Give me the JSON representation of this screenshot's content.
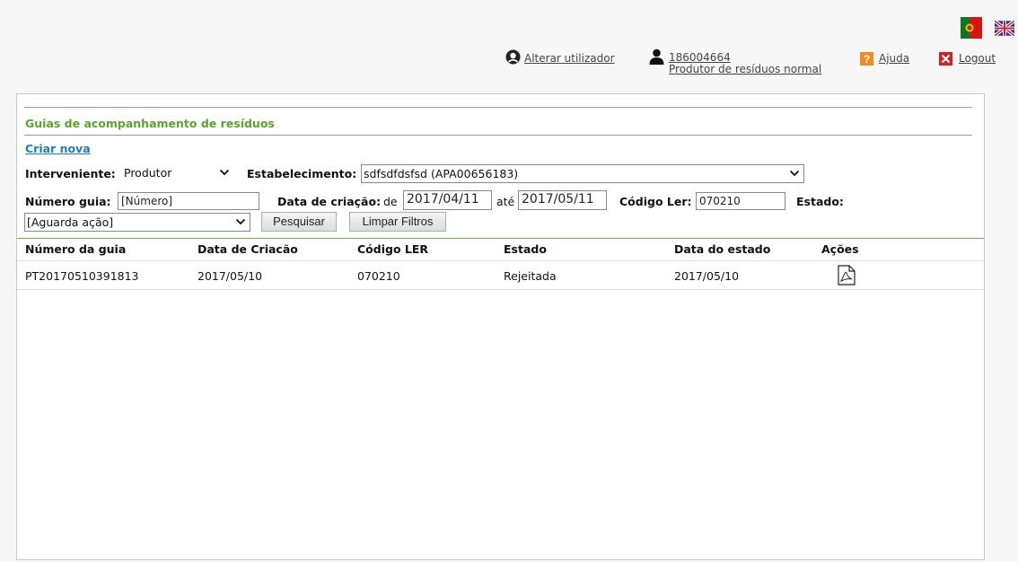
{
  "languages": [
    "Português",
    "English"
  ],
  "topbar": {
    "change_user": "Alterar utilizador",
    "user_id": "186004664",
    "user_role": "Produtor de resíduos normal",
    "help": "Ajuda",
    "logout": "Logout"
  },
  "main": {
    "section_title": "Guias de acompanhamento de resíduos",
    "create_link": "Criar nova",
    "filters": {
      "interveniente_label": "Interveniente:",
      "interveniente_value": "Produtor",
      "estabelecimento_label": "Estabelecimento:",
      "estabelecimento_value": "sdfsdfdsfsd (APA00656183)",
      "numero_label": "Número guia:",
      "numero_placeholder": "[Número]",
      "data_label": "Data de criação:",
      "de_label": "de",
      "date_from": "2017/04/11",
      "ate_label": "até",
      "date_to": "2017/05/11",
      "codigo_label": "Código Ler:",
      "codigo_value": "070210",
      "estado_label": "Estado:",
      "estado_value": "[Aguarda ação]",
      "search_button": "Pesquisar",
      "clear_button": "Limpar Filtros"
    },
    "table": {
      "columns": [
        "Número da guia",
        "Data de Criacão",
        "Código LER",
        "Estado",
        "Data do estado",
        "Ações"
      ],
      "rows": [
        {
          "numero": "PT20170510391813",
          "data_criacao": "2017/05/10",
          "codigo": "070210",
          "estado": "Rejeitada",
          "data_estado": "2017/05/10",
          "acao_icon": "pdf-icon"
        }
      ]
    }
  },
  "colors": {
    "accent_green": "#5aa52c",
    "link_blue": "#1e7fbf",
    "table_rule": "#6cba46"
  }
}
